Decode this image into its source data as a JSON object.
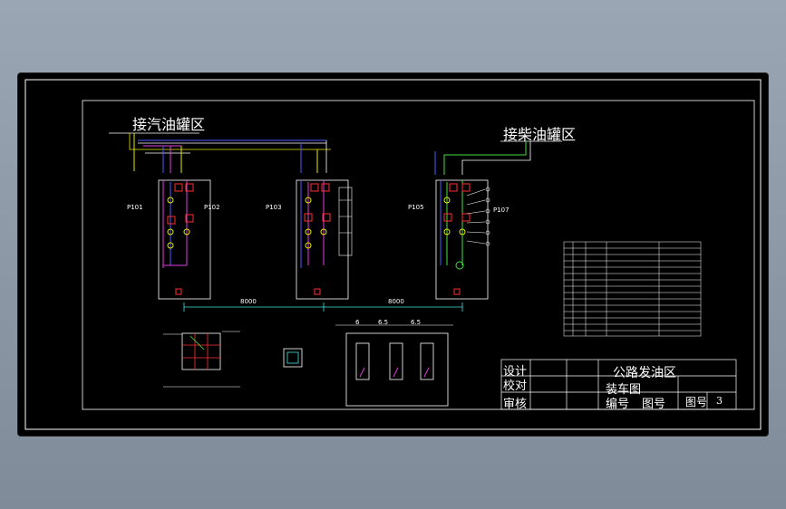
{
  "drawing": {
    "area_titles": {
      "gasoline_tank_area": "接汽油罐区",
      "diesel_tank_area": "接柴油罐区"
    },
    "dimensions": [
      "8000",
      "8000"
    ],
    "pump_labels": [
      "P101",
      "P102",
      "P103",
      "P105",
      "P107"
    ],
    "plan_dims": [
      "6",
      "6.5",
      "6.5"
    ],
    "title_block": {
      "project_name": "公路发油区",
      "drawing_name": "装车图",
      "row_labels": [
        "设计",
        "校对",
        "审核"
      ],
      "drawing_no_label": "图号",
      "drawing_no_value": "3",
      "stacked_labels": [
        "编号",
        "图号"
      ]
    }
  },
  "colors": {
    "background": "#000000",
    "line_white": "#ffffff",
    "line_blue": "#4a5cff",
    "line_magenta": "#e040e0",
    "line_yellow": "#e8e800",
    "line_green": "#40e040",
    "line_red": "#ff3030",
    "line_cyan": "#40e0e0"
  }
}
